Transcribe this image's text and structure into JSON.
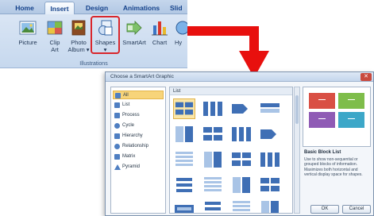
{
  "ribbon": {
    "tabs": [
      {
        "label": "Home",
        "active": false
      },
      {
        "label": "Insert",
        "active": true
      },
      {
        "label": "Design",
        "active": false
      },
      {
        "label": "Animations",
        "active": false
      },
      {
        "label": "Slid",
        "active": false
      }
    ],
    "buttons": [
      {
        "label": "Picture",
        "icon": "picture-icon"
      },
      {
        "label": "Clip\nArt",
        "icon": "clip-art-icon"
      },
      {
        "label": "Photo\nAlbum ▾",
        "icon": "photo-album-icon"
      },
      {
        "label": "Shapes\n▾",
        "icon": "shapes-icon",
        "highlighted": true
      },
      {
        "label": "SmartArt",
        "icon": "smartart-icon"
      },
      {
        "label": "Chart",
        "icon": "chart-icon"
      },
      {
        "label": "Hy",
        "icon": "hyperlink-icon"
      }
    ],
    "group_label": "Illustrations"
  },
  "colors": {
    "highlight_red": "#d9262c",
    "arrow_red": "#e8100e",
    "ribbon_blue": "#c6d8ee",
    "thumb_blue": "#3f6fb5",
    "selected_yellow": "#f7d47a"
  },
  "dialog": {
    "title": "Choose a SmartArt Graphic",
    "close_label": "✕",
    "categories": [
      {
        "label": "All",
        "selected": true
      },
      {
        "label": "List"
      },
      {
        "label": "Process"
      },
      {
        "label": "Cycle"
      },
      {
        "label": "Hierarchy"
      },
      {
        "label": "Relationship"
      },
      {
        "label": "Matrix"
      },
      {
        "label": "Pyramid"
      }
    ],
    "gallery_header": "List",
    "preview_colors": [
      "#d94f44",
      "#7ebd4a",
      "#8f5bb5",
      "#3ca7c8"
    ],
    "selected_title": "Basic Block List",
    "selected_description": "Use to show non-sequential or grouped blocks of information. Maximizes both horizontal and vertical display space for shapes.",
    "ok_label": "OK",
    "cancel_label": "Cancel"
  }
}
